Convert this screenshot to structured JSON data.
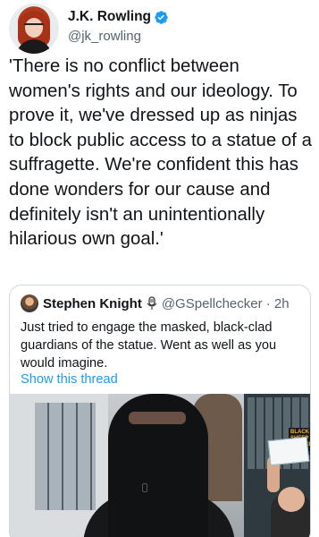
{
  "tweet": {
    "display_name": "J.K. Rowling",
    "handle": "@jk_rowling",
    "verified_icon": "verified-badge-icon",
    "text": "'There is no conflict between women's rights and our ideology. To prove it, we've dressed up as ninjas to block public access to a statue of a suffragette. We're confident this has done wonders for our cause and definitely isn't an unintentionally hilarious own goal.'"
  },
  "quote": {
    "display_name": "Stephen Knight",
    "name_icon": "microphone-icon",
    "handle_time": "@GSpellchecker · 2h",
    "text": "Just tried to engage the masked, black-clad guardians of the statue. Went as well as you would imagine.",
    "show_thread": "Show this thread",
    "media_sign": "BLACK SHEEP COFFEE"
  },
  "colors": {
    "text": "#0f1419",
    "secondary": "#536471",
    "link": "#1d9bf0",
    "verified": "#1d9bf0",
    "border": "#cfd9de"
  }
}
